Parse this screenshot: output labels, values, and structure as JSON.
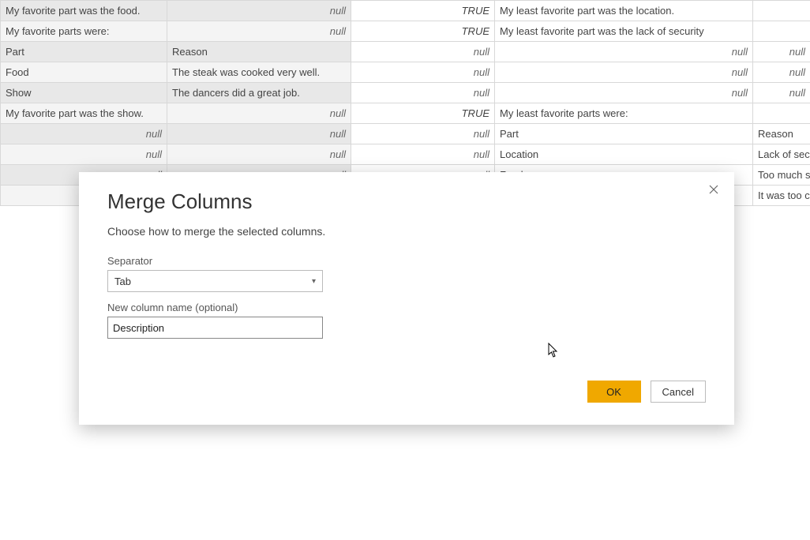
{
  "null_label": "null",
  "true_label": "TRUE",
  "table": {
    "rows": [
      {
        "c1": "My favorite part was the food.",
        "c2_null": true,
        "c3_true": true,
        "c4": "My least favorite part was the location.",
        "c5": ""
      },
      {
        "c1": "My favorite parts were:",
        "c2_null": true,
        "c3_true": true,
        "c4": "My least favorite part was  the lack of security",
        "c5": ""
      },
      {
        "c1": "Part",
        "c2": "Reason",
        "c3_null": true,
        "c4_null": true,
        "c5_null": true
      },
      {
        "c1": "Food",
        "c2": "The steak was cooked very well.",
        "c3_null": true,
        "c4_null": true,
        "c5_null": true
      },
      {
        "c1": "Show",
        "c2": "The dancers did a great job.",
        "c3_null": true,
        "c4_null": true,
        "c5_null": true
      },
      {
        "c1": "My favorite part was the show.",
        "c2_null": true,
        "c3_true": true,
        "c4": "My least favorite parts were:",
        "c5": ""
      },
      {
        "c1_null": true,
        "c2_null": true,
        "c3_null": true,
        "c4": "Part",
        "c5": "Reason"
      },
      {
        "c1_null": true,
        "c2_null": true,
        "c3_null": true,
        "c4": "Location",
        "c5": "Lack of security"
      },
      {
        "c1_null": true,
        "c2_null": true,
        "c3_null": true,
        "c4": "Food",
        "c5": "Too much salt"
      },
      {
        "c1": "",
        "c2": "",
        "c3": "",
        "c4": "",
        "c5": "It was too cold"
      }
    ]
  },
  "dialog": {
    "title": "Merge Columns",
    "subtitle": "Choose how to merge the selected columns.",
    "separator_label": "Separator",
    "separator_value": "Tab",
    "newcol_label": "New column name (optional)",
    "newcol_value": "Description",
    "ok_label": "OK",
    "cancel_label": "Cancel"
  }
}
